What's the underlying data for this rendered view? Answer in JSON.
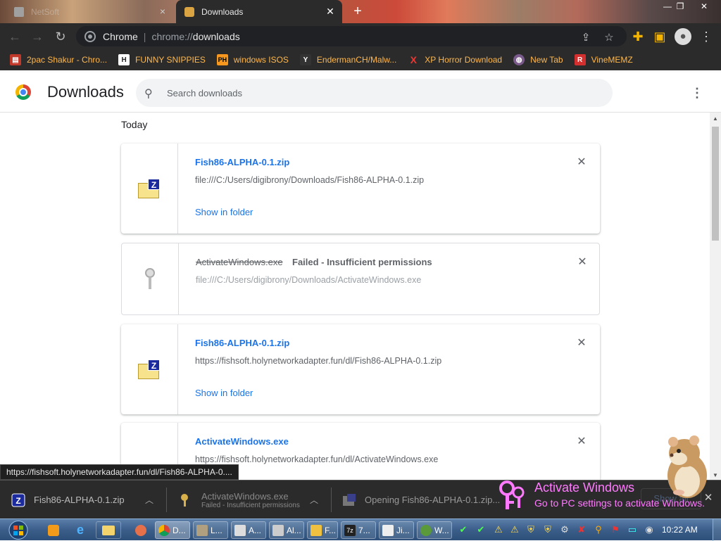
{
  "tabs": [
    {
      "title": "NetSoft",
      "active": false
    },
    {
      "title": "Downloads",
      "active": true
    }
  ],
  "omnibox": {
    "site": "Chrome",
    "scheme": "chrome://",
    "host": "downloads"
  },
  "bookmarks": [
    {
      "label": "2pac Shakur - Chro...",
      "icon": "store-icon",
      "color": "#c0392b"
    },
    {
      "label": "FUNNY SNIPPIES",
      "icon": "H",
      "color": "#222222"
    },
    {
      "label": "windows ISOS",
      "icon": "PH",
      "color": "#f7971e"
    },
    {
      "label": "EndermanCH/Malw...",
      "icon": "Y",
      "color": "#333333"
    },
    {
      "label": "XP Horror Download",
      "icon": "X",
      "color": "#e53935"
    },
    {
      "label": "New Tab",
      "icon": "globe-icon",
      "color": "#7a5a8a"
    },
    {
      "label": "VineMEMZ",
      "icon": "R",
      "color": "#d32f2f"
    }
  ],
  "header": {
    "title": "Downloads",
    "search_placeholder": "Search downloads"
  },
  "section": "Today",
  "downloads": [
    {
      "name": "Fish86-ALPHA-0.1.zip",
      "url": "file:///C:/Users/digibrony/Downloads/Fish86-ALPHA-0.1.zip",
      "action": "Show in folder",
      "status": ""
    },
    {
      "name": "ActivateWindows.exe",
      "url": "file:///C:/Users/digibrony/Downloads/ActivateWindows.exe",
      "action": "",
      "status": "Failed - Insufficient permissions"
    },
    {
      "name": "Fish86-ALPHA-0.1.zip",
      "url": "https://fishsoft.holynetworkadapter.fun/dl/Fish86-ALPHA-0.1.zip",
      "action": "Show in folder",
      "status": ""
    },
    {
      "name": "ActivateWindows.exe",
      "url": "https://fishsoft.holynetworkadapter.fun/dl/ActivateWindows.exe",
      "action": "",
      "status": ""
    }
  ],
  "status_bubble": "https://fishsoft.holynetworkadapter.fun/dl/Fish86-ALPHA-0....",
  "shelf": [
    {
      "name": "Fish86-ALPHA-0.1.zip",
      "sub": ""
    },
    {
      "name": "ActivateWindows.exe",
      "sub": "Failed - Insufficient permissions"
    },
    {
      "name": "Opening Fish86-ALPHA-0.1.zip...",
      "sub": ""
    }
  ],
  "activate": {
    "line1": "Activate Windows",
    "line2": "Go to PC settings to activate Windows."
  },
  "show_all": "Show all",
  "taskbar": {
    "tasks": [
      {
        "label": "D...",
        "icon": "chrome-icon"
      },
      {
        "label": "L...",
        "icon": "app-icon"
      },
      {
        "label": "A...",
        "icon": "app-icon"
      },
      {
        "label": "Al...",
        "icon": "app-icon"
      },
      {
        "label": "F...",
        "icon": "app-icon"
      },
      {
        "label": "7...",
        "icon": "7zip-icon"
      },
      {
        "label": "Ji...",
        "icon": "app-icon"
      },
      {
        "label": "W...",
        "icon": "app-icon"
      }
    ],
    "clock": "10:22 AM"
  }
}
